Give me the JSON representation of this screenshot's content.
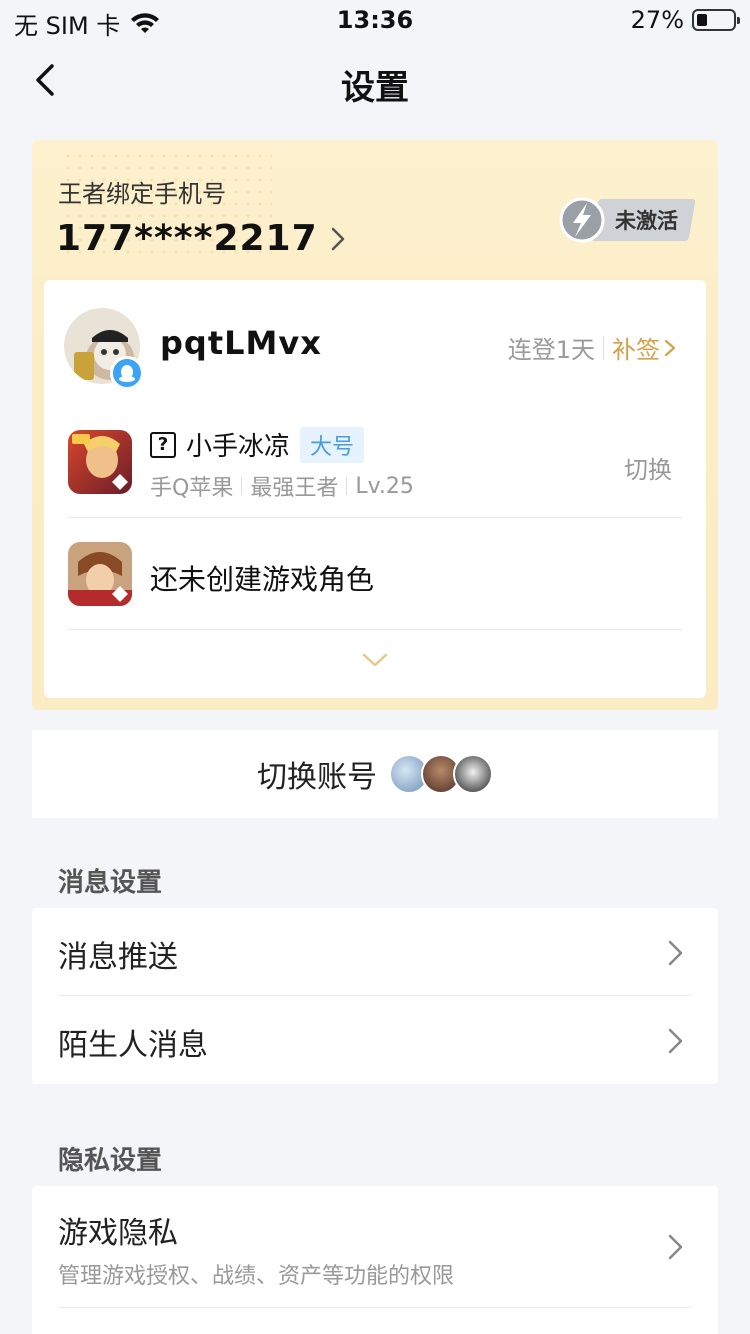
{
  "status_bar": {
    "carrier": "无 SIM 卡",
    "time": "13:36",
    "battery": "27%"
  },
  "nav": {
    "title": "设置"
  },
  "binding": {
    "label": "王者绑定手机号",
    "phone": "177****2217",
    "activation_status": "未激活"
  },
  "profile": {
    "username": "pqtLMvx",
    "login_streak": "连登1天",
    "make_up_checkin": "补签"
  },
  "games": [
    {
      "role_name": "小手冰凉",
      "tag": "大号",
      "platform": "手Q苹果",
      "rank": "最强王者",
      "level": "Lv.25",
      "action": "切换"
    },
    {
      "no_role_text": "还未创建游戏角色"
    }
  ],
  "switch_account": {
    "label": "切换账号"
  },
  "sections": [
    {
      "title": "消息设置",
      "items": [
        {
          "label": "消息推送"
        },
        {
          "label": "陌生人消息"
        }
      ]
    },
    {
      "title": "隐私设置",
      "items": [
        {
          "label": "游戏隐私",
          "desc": "管理游戏授权、战绩、资产等功能的权限"
        }
      ]
    }
  ],
  "colors": {
    "accent_gold": "#d4a148",
    "tag_blue": "#4a9be0",
    "qq_blue": "#3aa4f6",
    "card_gold": "#fdf1cf"
  },
  "icons": {
    "back": "chevron-left-icon",
    "chevron": "chevron-right-icon",
    "expand": "chevron-down-icon",
    "wifi": "wifi-icon",
    "battery": "battery-icon"
  }
}
